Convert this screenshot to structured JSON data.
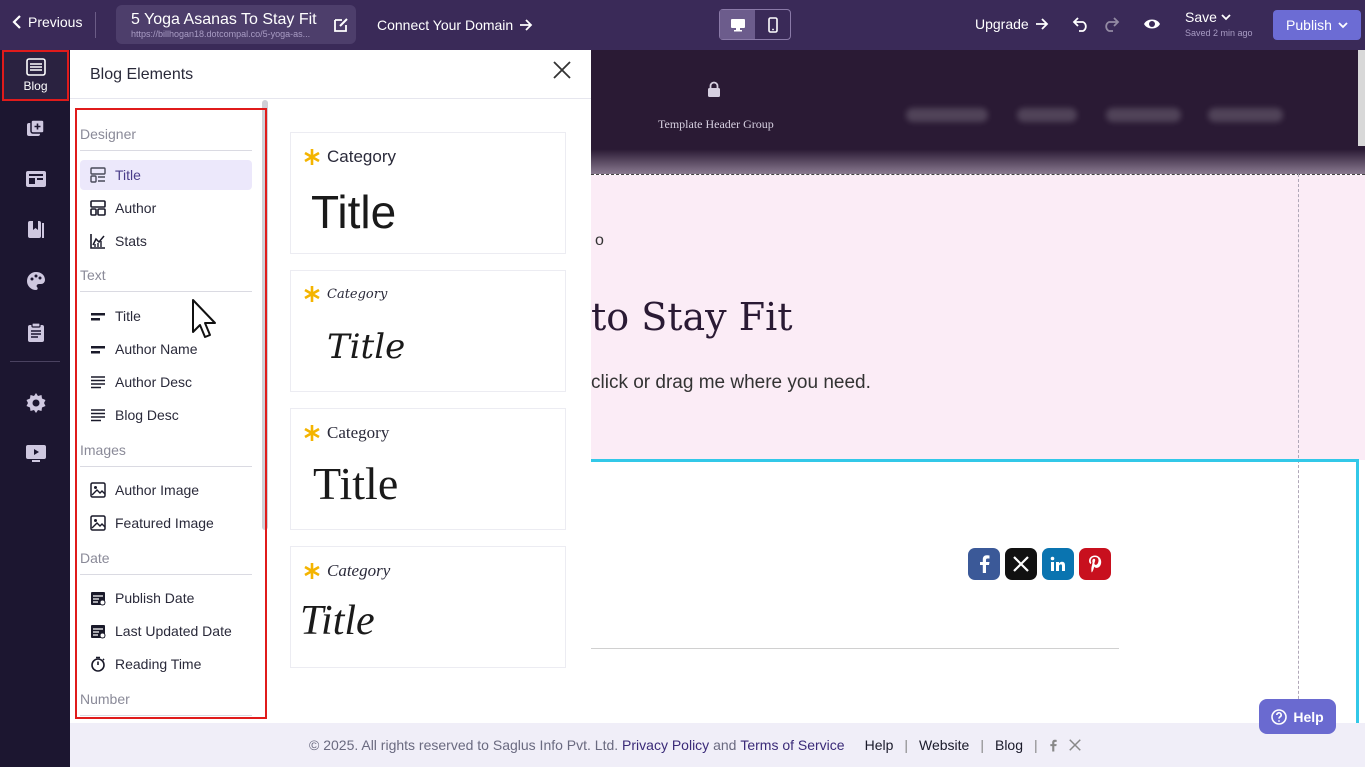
{
  "topbar": {
    "previous_label": "Previous",
    "page_title": "5 Yoga Asanas To Stay Fit",
    "page_url": "https://billhogan18.dotcompal.co/5-yoga-as...",
    "connect_domain_label": "Connect Your Domain",
    "upgrade_label": "Upgrade",
    "save_label": "Save",
    "saved_status": "Saved 2 min ago",
    "publish_label": "Publish"
  },
  "rail": {
    "blog_label": "Blog"
  },
  "panel": {
    "title": "Blog Elements",
    "sections": [
      {
        "name": "Designer",
        "items": [
          {
            "label": "Title",
            "icon": "designer-title-icon"
          },
          {
            "label": "Author",
            "icon": "designer-author-icon"
          },
          {
            "label": "Stats",
            "icon": "stats-chart-icon"
          }
        ]
      },
      {
        "name": "Text",
        "items": [
          {
            "label": "Title",
            "icon": "text-title-icon"
          },
          {
            "label": "Author Name",
            "icon": "text-author-name-icon"
          },
          {
            "label": "Author Desc",
            "icon": "text-lines-icon"
          },
          {
            "label": "Blog Desc",
            "icon": "text-lines-icon"
          }
        ]
      },
      {
        "name": "Images",
        "items": [
          {
            "label": "Author Image",
            "icon": "image-icon"
          },
          {
            "label": "Featured Image",
            "icon": "image-icon"
          }
        ]
      },
      {
        "name": "Date",
        "items": [
          {
            "label": "Publish Date",
            "icon": "calendar-icon"
          },
          {
            "label": "Last Updated Date",
            "icon": "calendar-icon"
          },
          {
            "label": "Reading Time",
            "icon": "stopwatch-icon"
          }
        ]
      },
      {
        "name": "Number",
        "items": []
      }
    ],
    "cards": [
      {
        "category": "Category",
        "title": "Title"
      },
      {
        "category": "Category",
        "title": "Title"
      },
      {
        "category": "Category",
        "title": "Title"
      },
      {
        "category": "Category",
        "title": "Title"
      }
    ]
  },
  "canvas": {
    "header_group_label": "Template Header Group",
    "partial_text": "o",
    "heading_partial": "to Stay Fit",
    "subtext_partial": "click or drag me where you need."
  },
  "footer": {
    "copyright": "©  2025. All rights reserved to Saglus Info Pvt. Ltd.",
    "privacy": "Privacy Policy",
    "and": "and",
    "terms": "Terms of Service",
    "help": "Help",
    "website": "Website",
    "blog": "Blog"
  },
  "help_button": "Help",
  "colors": {
    "topbar": "#3a2a58",
    "rail": "#1c1630",
    "publish": "#6c6cd4",
    "highlight_red": "#e01b1b",
    "selection_cyan": "#32c8e8",
    "accent_star": "#f4b400"
  }
}
